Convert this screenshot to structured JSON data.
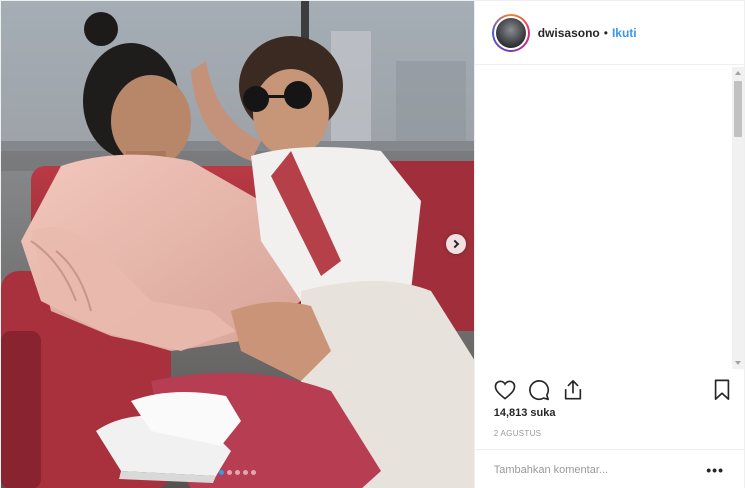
{
  "post": {
    "username": "dwisasono",
    "separator": "•",
    "follow_label": "Ikuti",
    "likes": "14,813 suka",
    "date": "2 AGUSTUS",
    "comment_placeholder": "Tambahkan komentar...",
    "more_label": "•••"
  },
  "carousel": {
    "slide_count": 5,
    "active_index": 0
  },
  "icons": [
    "heart-icon",
    "comment-icon",
    "share-icon",
    "bookmark-icon",
    "next-arrow-icon"
  ],
  "colors": {
    "accent": "#3897f0",
    "text": "#262626",
    "muted": "#999999",
    "border": "#efefef"
  }
}
